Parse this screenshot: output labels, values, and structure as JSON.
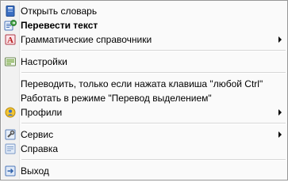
{
  "menu": {
    "items": [
      {
        "label": "Открыть словарь",
        "icon": "dictionary-book-icon"
      },
      {
        "label": "Перевести текст",
        "icon": "translate-text-icon",
        "bold": true
      },
      {
        "label": "Грамматические справочники",
        "icon": "grammar-reference-icon",
        "submenu": true
      },
      {
        "label": "Настройки",
        "icon": "settings-icon"
      },
      {
        "label": "Переводить, только если нажата клавиша \"любой Ctrl\""
      },
      {
        "label": "Работать в режиме \"Перевод выделением\""
      },
      {
        "label": "Профили",
        "icon": "profiles-icon",
        "submenu": true
      },
      {
        "label": "Сервис",
        "icon": "service-icon",
        "submenu": true
      },
      {
        "label": "Справка",
        "icon": "help-icon"
      },
      {
        "label": "Выход",
        "icon": "exit-icon"
      }
    ]
  }
}
